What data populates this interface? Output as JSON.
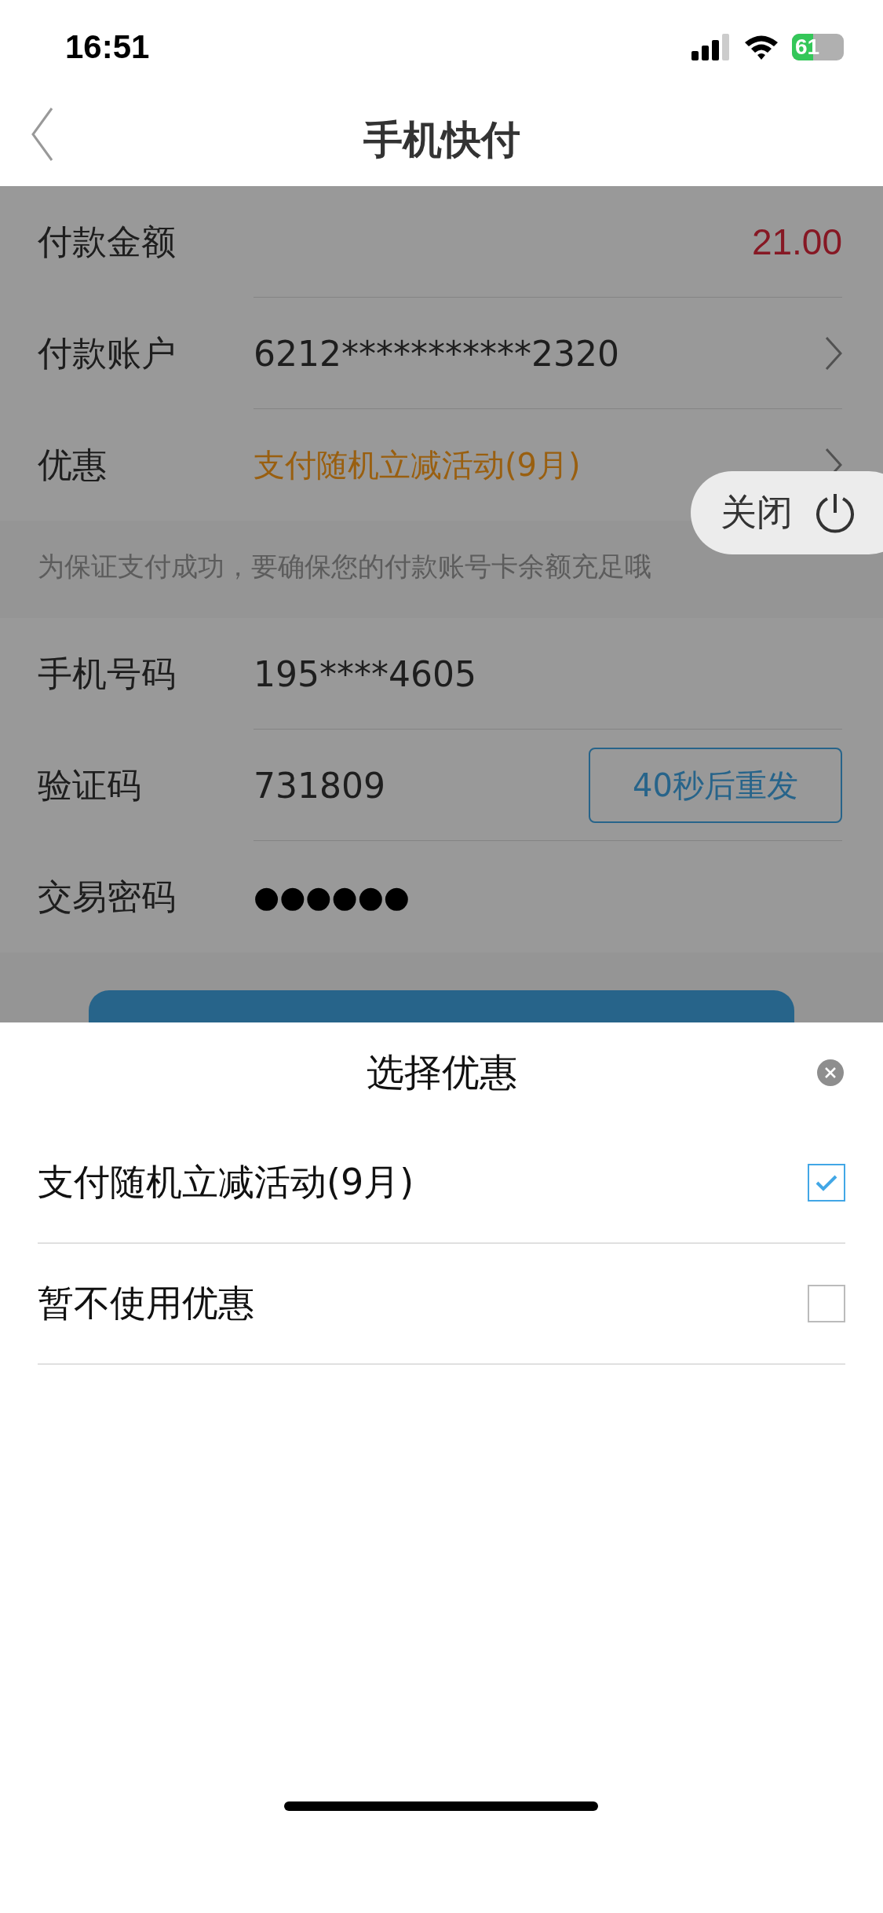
{
  "status_bar": {
    "time": "16:51",
    "battery": "61"
  },
  "nav": {
    "title": "手机快付"
  },
  "payment": [
    {
      "label": "付款金额",
      "value": "21.00",
      "kind": "amount"
    },
    {
      "label": "付款账户",
      "value": "6212***********2320",
      "kind": "link"
    },
    {
      "label": "优惠",
      "value": "支付随机立减活动(9月)",
      "kind": "promo"
    }
  ],
  "notice": "为保证支付成功，要确保您的付款账号卡余额充足哦",
  "verification": [
    {
      "label": "手机号码",
      "value": "195****4605",
      "kind": "text"
    },
    {
      "label": "验证码",
      "value": "731809",
      "kind": "code",
      "action": "40秒后重发"
    },
    {
      "label": "交易密码",
      "value": "●●●●●●",
      "kind": "password"
    }
  ],
  "floating_close": {
    "label": "关闭"
  },
  "sheet": {
    "title": "选择优惠",
    "options": [
      {
        "label": "支付随机立减活动(9月)",
        "checked": true
      },
      {
        "label": "暂不使用优惠",
        "checked": false
      }
    ]
  }
}
